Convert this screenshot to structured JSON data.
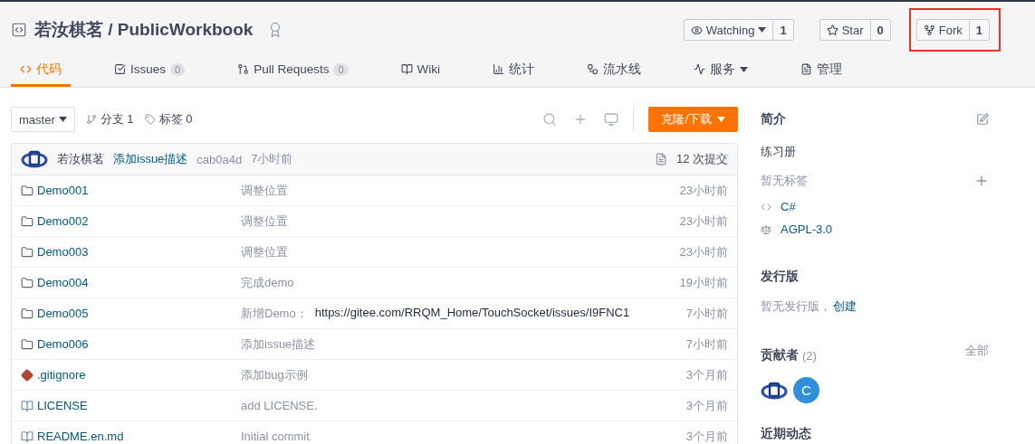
{
  "repo": {
    "owner": "若汝棋茗",
    "separator": "/",
    "name": "PublicWorkbook"
  },
  "repo_actions": [
    {
      "kind": "watch",
      "label": "Watching",
      "count": "1",
      "has_menu": true,
      "highlighted": false
    },
    {
      "kind": "star",
      "label": "Star",
      "count": "0",
      "has_menu": false,
      "highlighted": false
    },
    {
      "kind": "fork",
      "label": "Fork",
      "count": "1",
      "has_menu": false,
      "highlighted": true
    }
  ],
  "tabs": [
    {
      "kind": "code",
      "label": "代码",
      "selected": true,
      "has_menu": false
    },
    {
      "kind": "issues",
      "label": "Issues",
      "count": "0",
      "selected": false,
      "has_menu": false
    },
    {
      "kind": "pulls",
      "label": "Pull Requests",
      "count": "0",
      "selected": false,
      "has_menu": false
    },
    {
      "kind": "wiki",
      "label": "Wiki",
      "selected": false,
      "has_menu": false
    },
    {
      "kind": "stats",
      "label": "统计",
      "selected": false,
      "has_menu": false
    },
    {
      "kind": "pipeline",
      "label": "流水线",
      "selected": false,
      "has_menu": false
    },
    {
      "kind": "services",
      "label": "服务",
      "selected": false,
      "has_menu": true
    },
    {
      "kind": "manage",
      "label": "管理",
      "selected": false,
      "has_menu": false
    }
  ],
  "branch_bar": {
    "branch": "master",
    "branches": "分支 1",
    "tags": "标签 0",
    "clone_button": "克隆/下载"
  },
  "latest_commit": {
    "author": "若汝棋茗",
    "message": "添加issue描述",
    "hash": "cab0a4d",
    "time": "7小时前",
    "commits": "12 次提交"
  },
  "files": [
    {
      "kind": "folder",
      "name": "Demo001",
      "message": "调整位置",
      "time": "23小时前"
    },
    {
      "kind": "folder",
      "name": "Demo002",
      "message": "调整位置",
      "time": "23小时前"
    },
    {
      "kind": "folder",
      "name": "Demo003",
      "message": "调整位置",
      "time": "23小时前"
    },
    {
      "kind": "folder",
      "name": "Demo004",
      "message": "完成demo",
      "time": "19小时前"
    },
    {
      "kind": "folder",
      "name": "Demo005",
      "message": "新增Demo：",
      "link": "https://gitee.com/RRQM_Home/TouchSocket/issues/I9FNC1",
      "time": "7小时前"
    },
    {
      "kind": "folder",
      "name": "Demo006",
      "message": "添加issue描述",
      "time": "7小时前"
    },
    {
      "kind": "git",
      "name": ".gitignore",
      "message": "添加bug示例",
      "time": "3个月前"
    },
    {
      "kind": "doc",
      "name": "LICENSE",
      "message": "add LICENSE.",
      "time": "3个月前"
    },
    {
      "kind": "doc",
      "name": "README.en.md",
      "message": "Initial commit",
      "time": "3个月前"
    }
  ],
  "sidebar": {
    "about": {
      "title": "简介",
      "description": "练习册",
      "tags": "暂无标签",
      "language": "C#",
      "license": "AGPL-3.0"
    },
    "releases": {
      "title": "发行版",
      "text": "暂无发行版，",
      "link": "创建"
    },
    "contributors": {
      "title": "贡献者",
      "count": "(2)",
      "all": "全部",
      "people": [
        {
          "kind": "logo"
        },
        {
          "kind": "initial",
          "initial": "C"
        }
      ]
    },
    "activity": {
      "title": "近期动态"
    }
  }
}
